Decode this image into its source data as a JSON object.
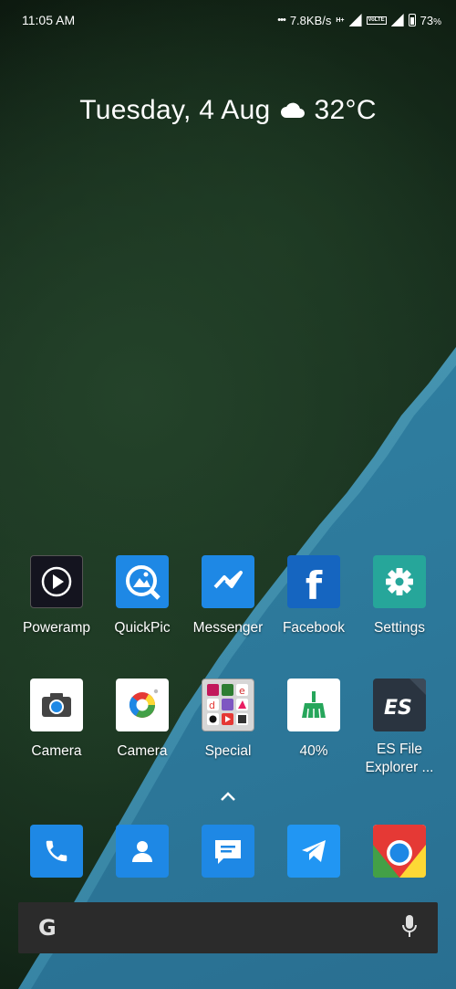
{
  "status_bar": {
    "time": "11:05 AM",
    "speed": "7.8KB/s",
    "sim1_tech": "H+",
    "sim2_tech": "VoLTE",
    "battery": "73",
    "battery_unit": "%"
  },
  "date_widget": {
    "date": "Tuesday, 4 Aug",
    "weather_icon": "cloud-icon",
    "temperature": "32°C"
  },
  "home_row1": [
    {
      "label": "Poweramp",
      "icon": "poweramp-icon",
      "color": "#1a1a2e"
    },
    {
      "label": "QuickPic",
      "icon": "quickpic-icon",
      "color": "#1e88e5"
    },
    {
      "label": "Messenger",
      "icon": "messenger-icon",
      "color": "#1e88e5"
    },
    {
      "label": "Facebook",
      "icon": "facebook-icon",
      "color": "#1565c0"
    },
    {
      "label": "Settings",
      "icon": "gear-icon",
      "color": "#26a69a"
    }
  ],
  "home_row2": [
    {
      "label": "Camera",
      "icon": "camera-icon",
      "color": "#ffffff"
    },
    {
      "label": "Camera",
      "icon": "camera-lens-icon",
      "color": "#ffffff"
    },
    {
      "label": "Special",
      "icon": "folder-icon",
      "color": "#c9c9c9"
    },
    {
      "label": "40%",
      "icon": "broom-icon",
      "color": "#ffffff"
    },
    {
      "label": "ES File Explorer ...",
      "icon": "es-file-explorer-icon",
      "color": "#2a3440"
    }
  ],
  "dock": [
    {
      "icon": "phone-icon",
      "color": "#1e88e5"
    },
    {
      "icon": "contacts-icon",
      "color": "#1e88e5"
    },
    {
      "icon": "messages-icon",
      "color": "#1e88e5"
    },
    {
      "icon": "telegram-icon",
      "color": "#2196f3"
    },
    {
      "icon": "chrome-icon",
      "color": "#ffffff"
    }
  ],
  "search_bar": {
    "logo": "G",
    "mic_icon": "microphone-icon"
  }
}
